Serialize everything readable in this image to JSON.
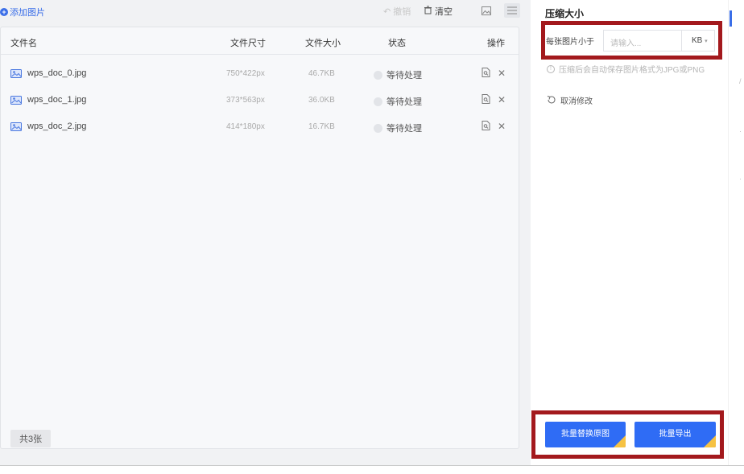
{
  "toolbar": {
    "add_label": "添加图片",
    "disabled_label": "撤销",
    "clear_label": "清空"
  },
  "table": {
    "headers": {
      "name": "文件名",
      "dimensions": "文件尺寸",
      "size": "文件大小",
      "status": "状态",
      "actions": "操作"
    },
    "rows": [
      {
        "name": "wps_doc_0.jpg",
        "dimensions": "750*422px",
        "size": "46.7KB",
        "status": "等待处理"
      },
      {
        "name": "wps_doc_1.jpg",
        "dimensions": "373*563px",
        "size": "36.0KB",
        "status": "等待处理"
      },
      {
        "name": "wps_doc_2.jpg",
        "dimensions": "414*180px",
        "size": "16.7KB",
        "status": "等待处理"
      }
    ],
    "count_label": "共3张"
  },
  "settings": {
    "title": "压缩大小",
    "limit_label": "每张图片小于",
    "input_placeholder": "请输入...",
    "unit": "KB",
    "hint": "压缩后会自动保存图片格式为JPG或PNG",
    "undo_label": "取消修改",
    "replace_button": "批量替换原图",
    "export_button": "批量导出"
  },
  "colors": {
    "accent": "#2f6cf5",
    "annotation": "#a3191d",
    "vip_corner": "#f6c243"
  }
}
